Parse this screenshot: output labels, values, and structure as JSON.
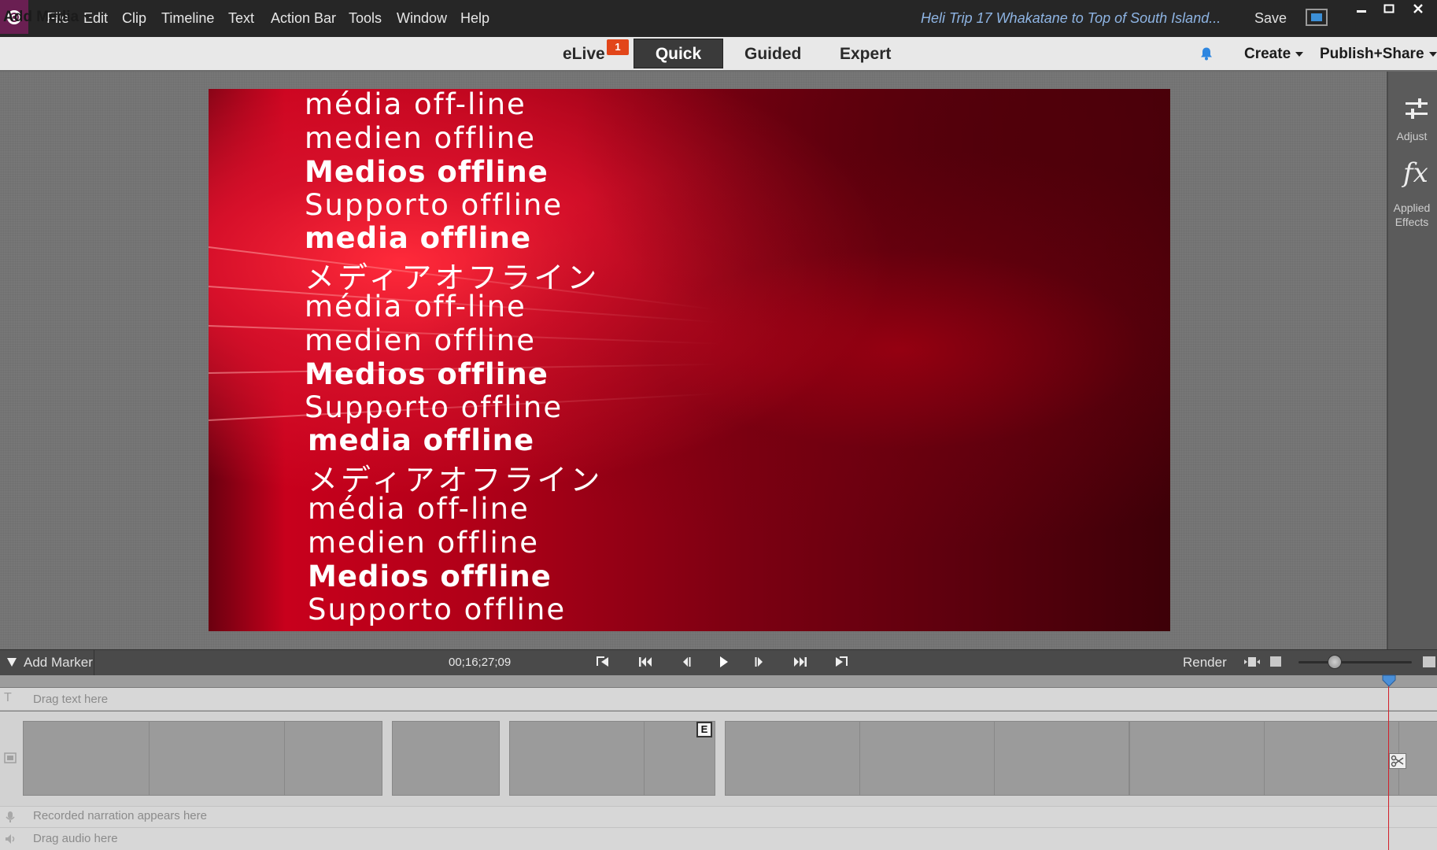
{
  "menubar": {
    "items": [
      "File",
      "Edit",
      "Clip",
      "Timeline",
      "Text",
      "Action Bar",
      "Tools",
      "Window",
      "Help"
    ],
    "doc_title": "Heli Trip 17 Whakatane to Top of South Island...",
    "save_label": "Save",
    "window_controls": [
      "minimize-icon",
      "restore-icon",
      "close-icon"
    ]
  },
  "modebar": {
    "add_media": "Add Media",
    "elive": "eLive",
    "elive_badge": "1",
    "tabs": [
      "Quick",
      "Guided",
      "Expert"
    ],
    "active_tab": "Quick",
    "create": "Create",
    "publish": "Publish+Share"
  },
  "preview": {
    "lines": [
      "média off-line",
      "medien offline",
      "Medios offline",
      "Supporto offline",
      "media offline",
      "メディアオフライン",
      "média off-line",
      "medien offline",
      "Medios offline",
      "Supporto offline",
      "media offline",
      "メディアオフライン",
      "média off-line",
      "medien offline",
      "Medios offline",
      "Supporto offline"
    ]
  },
  "right_panel": {
    "adjust": "Adjust",
    "applied_effects_1": "Applied",
    "applied_effects_2": "Effects",
    "fx": "fx"
  },
  "transport": {
    "add_marker": "Add Marker",
    "timecode": "00;16;27;09",
    "render": "Render",
    "buttons": [
      "go-to-in-icon",
      "skip-back-icon",
      "step-back-icon",
      "play-icon",
      "step-forward-icon",
      "skip-forward-icon",
      "go-to-out-icon"
    ]
  },
  "timeline": {
    "text_track": "Drag text here",
    "narration_track": "Recorded narration appears here",
    "audio_track": "Drag audio here",
    "end_marker": "E"
  },
  "colors": {
    "menubar_bg": "#262626",
    "title_blue": "#8eb4e3",
    "badge_orange": "#e2461a",
    "playhead_red": "#d2202a",
    "bell_blue": "#2d86e0"
  }
}
